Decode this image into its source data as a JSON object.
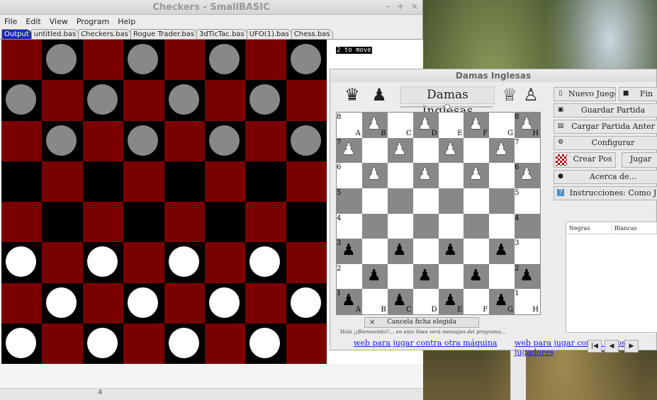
{
  "smallbasic": {
    "title": "Checkers - SmallBASIC",
    "window_controls": [
      "–",
      "+",
      "×"
    ],
    "menu": [
      "File",
      "Edit",
      "View",
      "Program",
      "Help"
    ],
    "tabs": [
      "Output",
      "untitled.bas",
      "Checkers.bas",
      "Rogue Trader.bas",
      "3dTicTac.bas",
      "UFO(1).bas",
      "Chess.bas"
    ],
    "output_text": "2 to move",
    "footer_number": "4",
    "board": [
      [
        "red",
        "gray",
        "red",
        "gray",
        "red",
        "gray",
        "red",
        "gray"
      ],
      [
        "gray",
        "red",
        "gray",
        "red",
        "gray",
        "red",
        "gray",
        "red"
      ],
      [
        "red",
        "gray",
        "red",
        "gray",
        "red",
        "gray",
        "red",
        "gray"
      ],
      [
        "black",
        "red",
        "black",
        "red",
        "black",
        "red",
        "black",
        "red"
      ],
      [
        "red",
        "black",
        "red",
        "black",
        "red",
        "black",
        "red",
        "black"
      ],
      [
        "white",
        "red",
        "white",
        "red",
        "white",
        "red",
        "white",
        "red"
      ],
      [
        "red",
        "white",
        "red",
        "white",
        "red",
        "white",
        "red",
        "white"
      ],
      [
        "white",
        "red",
        "white",
        "red",
        "white",
        "red",
        "white",
        "red"
      ]
    ]
  },
  "damas": {
    "title": "Damas Inglesas",
    "header_title": "Damas Inglesas",
    "header_icons": [
      "♛",
      "♟",
      "♕",
      "♙"
    ],
    "buttons": {
      "nuevo": "Nuevo Juego",
      "fin": "Fin",
      "guardar": "Guardar Partida",
      "cargar": "Cargar Partida Anter",
      "configurar": "Configurar",
      "crear": "Crear Pos",
      "jugar": "Jugar",
      "acerca": "Acerca de...",
      "instrucciones": "Instrucciones: Como J"
    },
    "table_headers": [
      "Negras",
      "Blancas"
    ],
    "cancel_label": "Cancela ficha elegida",
    "status": "Hola ¡¡Bienvenido!!... en esta línea verá mensajes del programa...",
    "link_left": "web para jugar contra otra máquina",
    "link_right": "web para jugar contra otros jugadores",
    "nav": [
      "|◀",
      "◀",
      "▶"
    ],
    "ranks": [
      "8",
      "7",
      "6",
      "5",
      "4",
      "3",
      "2",
      "1"
    ],
    "files": [
      "A",
      "B",
      "C",
      "D",
      "E",
      "F",
      "G",
      "H"
    ],
    "board": [
      [
        "",
        "w",
        "",
        "w",
        "",
        "w",
        "",
        "w"
      ],
      [
        "w",
        "",
        "w",
        "",
        "w",
        "",
        "w",
        ""
      ],
      [
        "",
        "w",
        "",
        "w",
        "",
        "w",
        "",
        "w"
      ],
      [
        "",
        "",
        "",
        "",
        "",
        "",
        "",
        ""
      ],
      [
        "",
        "",
        "",
        "",
        "",
        "",
        "",
        ""
      ],
      [
        "b",
        "",
        "b",
        "",
        "b",
        "",
        "b",
        ""
      ],
      [
        "",
        "b",
        "",
        "b",
        "",
        "b",
        "",
        "b"
      ],
      [
        "b",
        "",
        "b",
        "",
        "b",
        "",
        "b",
        ""
      ]
    ]
  }
}
